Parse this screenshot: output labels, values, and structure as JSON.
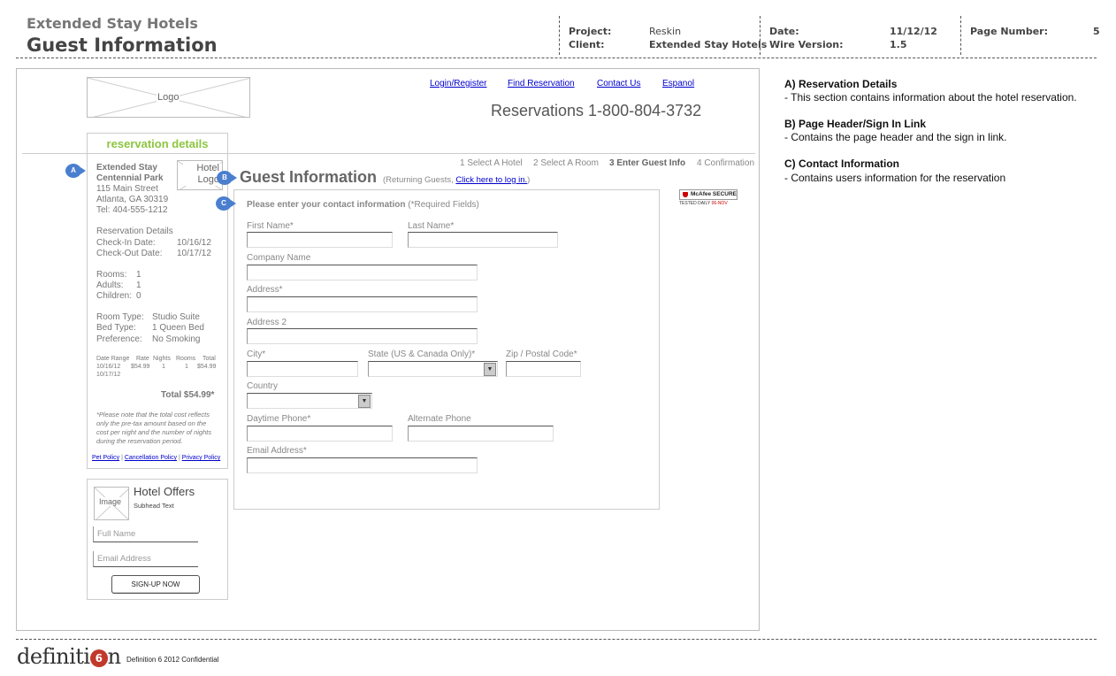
{
  "header": {
    "company": "Extended Stay Hotels",
    "title": "Guest Information",
    "project_label": "Project:",
    "project_value": "Reskin",
    "client_label": "Client:",
    "client_value": "Extended Stay Hotels",
    "date_label": "Date:",
    "date_value": "11/12/12",
    "wire_label": "Wire Version:",
    "wire_value": "1.5",
    "page_label": "Page Number:",
    "page_value": "5"
  },
  "wire": {
    "logo": "Logo",
    "top_links": [
      "Login/Register",
      "Find Reservation",
      "Contact Us",
      "Espanol"
    ],
    "reservations_phone": "Reservations 1-800-804-3732",
    "sidebar": {
      "title": "reservation details",
      "hotel_name_1": "Extended Stay",
      "hotel_name_2": "Centennial Park",
      "hotel_logo": "Hotel Logo",
      "address_1": "115 Main Street",
      "address_2": "Atlanta, GA 30319",
      "tel": "Tel: 404-555-1212",
      "details_heading": "Reservation Details",
      "checkin_label": "Check-In Date:",
      "checkin_value": "10/16/12",
      "checkout_label": "Check-Out Date:",
      "checkout_value": "10/17/12",
      "rooms_label": "Rooms:",
      "rooms_value": "1",
      "adults_label": "Adults:",
      "adults_value": "1",
      "children_label": "Children:",
      "children_value": "0",
      "roomtype_label": "Room Type:",
      "roomtype_value": "Studio Suite",
      "bedtype_label": "Bed Type:",
      "bedtype_value": "1 Queen Bed",
      "pref_label": "Preference:",
      "pref_value": "No Smoking",
      "table_headers": [
        "Date Range",
        "Rate",
        "Nights",
        "Rooms",
        "Total"
      ],
      "table_row": [
        "10/16/12",
        "$54.99",
        "1",
        "1",
        "$54.99"
      ],
      "table_row_2": "10/17/12",
      "total": "Total $54.99*",
      "disclaimer_1": "*Please note that the total cost reflects",
      "disclaimer_2": "only the pre-tax amount based on the",
      "disclaimer_3": "cost per night and the number of nights",
      "disclaimer_4": "during the reservation period.",
      "policies": [
        "Pet Policy",
        "Cancellation Policy",
        "Privacy Policy"
      ]
    },
    "offers": {
      "image": "Image",
      "title": "Hotel Offers",
      "subhead": "Subhead Text",
      "full_name_placeholder": "Full Name",
      "email_placeholder": "Email Address",
      "signup": "SIGN-UP NOW"
    },
    "badges": [
      "A",
      "B",
      "C"
    ],
    "steps": [
      "1 Select A Hotel",
      "2 Select A Room",
      "3 Enter Guest Info",
      "4 Confirmation"
    ],
    "gi_title": "Guest Information",
    "gi_returning": "(Returning Guests, ",
    "gi_login_link": "Click here to log in.",
    "gi_close": ")",
    "form_intro": "Please enter your contact information",
    "form_required": " (*Required Fields)",
    "fields": {
      "first_name": "First Name*",
      "last_name": "Last Name*",
      "company": "Company Name",
      "address": "Address*",
      "address2": "Address 2",
      "city": "City*",
      "state": "State (US & Canada Only)*",
      "zip": "Zip / Postal Code*",
      "country": "Country",
      "day_phone": "Daytime Phone*",
      "alt_phone": "Alternate Phone",
      "email": "Email Address*"
    },
    "mcafee_top": "McAfee SECURE",
    "mcafee_bottom": "TESTED DAILY",
    "mcafee_date": "06-NOV"
  },
  "notes": [
    {
      "head": "A) Reservation Details",
      "body": "- This section contains information about the hotel reservation."
    },
    {
      "head": "B) Page Header/Sign In Link",
      "body": "- Contains the page header and the sign in link."
    },
    {
      "head": "C) Contact Information",
      "body": "- Contains users information for the reservation"
    }
  ],
  "footer": {
    "logo_text_1": "definiti",
    "logo_o": "6",
    "logo_text_2": "n",
    "confidential": "Definition 6 2012 Confidential"
  }
}
